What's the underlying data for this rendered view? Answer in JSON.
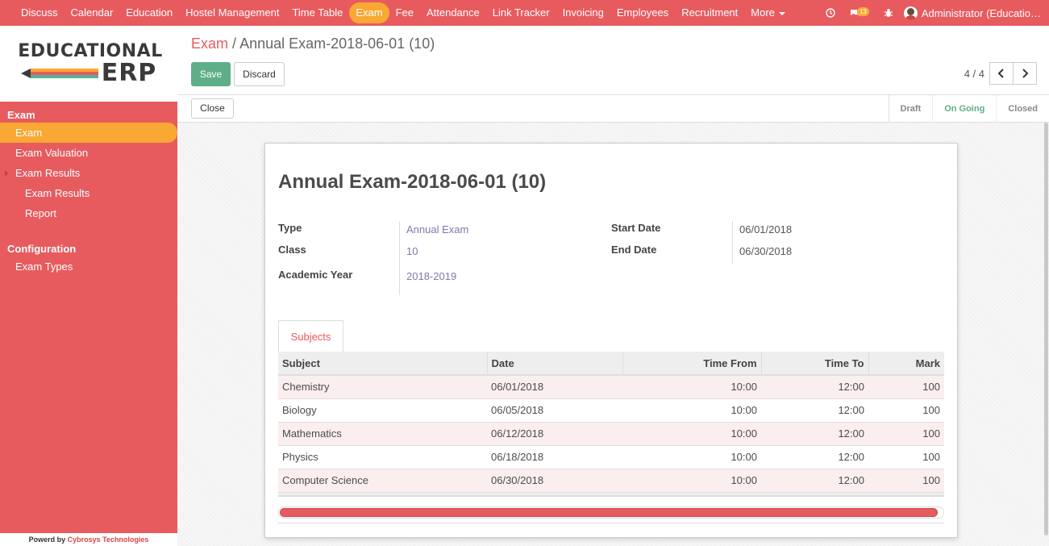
{
  "topbar": {
    "menu": [
      {
        "label": "Discuss",
        "active": false
      },
      {
        "label": "Calendar",
        "active": false
      },
      {
        "label": "Education",
        "active": false
      },
      {
        "label": "Hostel Management",
        "active": false
      },
      {
        "label": "Time Table",
        "active": false
      },
      {
        "label": "Exam",
        "active": true
      },
      {
        "label": "Fee",
        "active": false
      },
      {
        "label": "Attendance",
        "active": false
      },
      {
        "label": "Link Tracker",
        "active": false
      },
      {
        "label": "Invoicing",
        "active": false
      },
      {
        "label": "Employees",
        "active": false
      },
      {
        "label": "Recruitment",
        "active": false
      }
    ],
    "more_label": "More",
    "message_count": "13",
    "user_name": "Administrator (Educatio…"
  },
  "sidebar": {
    "logo_top": "EDUCATIONAL",
    "logo_bottom": "ERP",
    "sections": [
      {
        "header": "Exam",
        "items": [
          {
            "label": "Exam",
            "active": true,
            "sub": false,
            "arrow": false
          },
          {
            "label": "Exam Valuation",
            "active": false,
            "sub": false,
            "arrow": false
          },
          {
            "label": "Exam Results",
            "active": false,
            "sub": false,
            "arrow": true
          },
          {
            "label": "Exam Results",
            "active": false,
            "sub": true,
            "arrow": false
          },
          {
            "label": "Report",
            "active": false,
            "sub": true,
            "arrow": false
          }
        ]
      },
      {
        "header": "Configuration",
        "items": [
          {
            "label": "Exam Types",
            "active": false,
            "sub": false,
            "arrow": false
          }
        ]
      }
    ],
    "powered_prefix": "Powerd by ",
    "powered_brand": "Cybrosys Technologies"
  },
  "control": {
    "breadcrumb_parent": "Exam",
    "breadcrumb_separator": "/",
    "breadcrumb_current": "Annual Exam-2018-06-01 (10)",
    "save_label": "Save",
    "discard_label": "Discard",
    "pager": "4 / 4"
  },
  "statusbar": {
    "close_label": "Close",
    "stages": [
      {
        "label": "Draft",
        "current": false
      },
      {
        "label": "On Going",
        "current": true
      },
      {
        "label": "Closed",
        "current": false
      }
    ]
  },
  "form": {
    "title": "Annual Exam-2018-06-01 (10)",
    "type_label": "Type",
    "type_value": "Annual Exam",
    "class_label": "Class",
    "class_value": "10",
    "academic_year_label": "Academic Year",
    "academic_year_value": "2018-2019",
    "start_date_label": "Start Date",
    "start_date_value": "06/01/2018",
    "end_date_label": "End Date",
    "end_date_value": "06/30/2018",
    "tab_label": "Subjects"
  },
  "subjects": {
    "columns": [
      "Subject",
      "Date",
      "Time From",
      "Time To",
      "Mark"
    ],
    "rows": [
      [
        "Chemistry",
        "06/01/2018",
        "10:00",
        "12:00",
        "100"
      ],
      [
        "Biology",
        "06/05/2018",
        "10:00",
        "12:00",
        "100"
      ],
      [
        "Mathematics",
        "06/12/2018",
        "10:00",
        "12:00",
        "100"
      ],
      [
        "Physics",
        "06/18/2018",
        "10:00",
        "12:00",
        "100"
      ],
      [
        "Computer Science",
        "06/30/2018",
        "10:00",
        "12:00",
        "100"
      ]
    ]
  },
  "colors": {
    "brand": "#e75b5f",
    "accent": "#f8a833",
    "primary": "#5fae8a"
  }
}
